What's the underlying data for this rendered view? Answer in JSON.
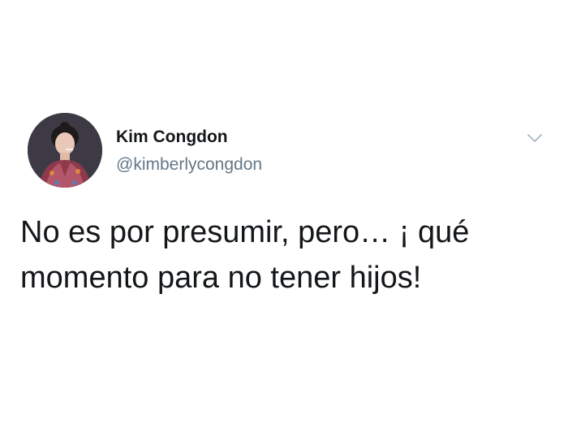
{
  "tweet": {
    "author": {
      "name": "Kim Congdon",
      "handle": "@kimberlycongdon",
      "avatar_icon": "profile-photo"
    },
    "menu_icon": "chevron-down-icon",
    "lines": [
      "No es por presumir, pero… ¡ qué",
      "momento para no tener hijos!"
    ]
  },
  "colors": {
    "name": "#14171a",
    "handle": "#657786",
    "text": "#14171a",
    "caret": "#aab8c2",
    "background": "#ffffff"
  }
}
